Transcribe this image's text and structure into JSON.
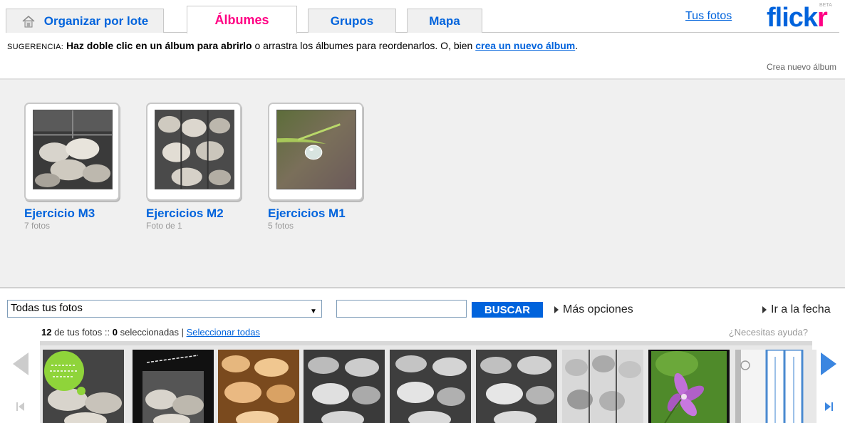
{
  "tabs": [
    {
      "label": "Organizar por lote"
    },
    {
      "label": "Álbumes"
    },
    {
      "label": "Grupos"
    },
    {
      "label": "Mapa"
    }
  ],
  "header": {
    "your_photos": "Tus fotos",
    "logo_blue": "flick",
    "logo_pink": "r",
    "logo_beta": "BETA"
  },
  "hint": {
    "prefix": "SUGERENCIA:",
    "bold": "Haz doble clic en un álbum para abrirlo",
    "middle": " o arrastra los álbumes para reordenarlos. O, bien ",
    "link": "crea un nuevo álbum",
    "end": "."
  },
  "new_album_link": "Crea nuevo álbum",
  "albums": [
    {
      "title": "Ejercicio M3",
      "count": "7 fotos"
    },
    {
      "title": "Ejercicios M2",
      "count": "Foto de 1"
    },
    {
      "title": "Ejercicios M1",
      "count": "5 fotos"
    }
  ],
  "filter": {
    "selected": "Todas tus fotos",
    "search_value": "",
    "search_button": "BUSCAR",
    "more_options": "Más opciones",
    "go_to_date": "Ir a la fecha"
  },
  "status": {
    "total": "12",
    "of_your_photos": " de tus fotos :: ",
    "selected": "0",
    "selected_label": " seleccionadas | ",
    "select_all": "Seleccionar todas",
    "help": "¿Necesitas ayuda?"
  },
  "colors": {
    "brand_blue": "#0063dc",
    "brand_pink": "#ff0084",
    "album_bg": "#f0f0f0"
  }
}
